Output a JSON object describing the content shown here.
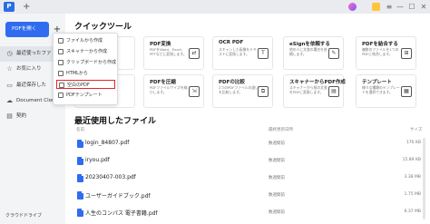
{
  "titlebar": {
    "logo": "P",
    "new_tab": "+"
  },
  "sidebar": {
    "create_button": "PDFを開く",
    "plus": "+",
    "items": [
      {
        "label": "最近使ったファ",
        "icon": "clock-icon",
        "active": true
      },
      {
        "label": "お気に入り",
        "icon": "star-icon",
        "active": false
      },
      {
        "label": "最近保存した",
        "icon": "folder-icon",
        "active": false
      },
      {
        "label": "Document Cloud",
        "icon": "cloud-icon",
        "active": false
      },
      {
        "label": "契約",
        "icon": "contract-icon",
        "active": false
      }
    ],
    "cloud_drive": "クラウドドライブ"
  },
  "menu": {
    "items": [
      {
        "label": "ファイルから作成"
      },
      {
        "label": "スキャナーから作成"
      },
      {
        "label": "クリップボードから作成"
      },
      {
        "label": "HTMLから"
      },
      {
        "label": "空白のPDF"
      },
      {
        "label": "PDFテンプレート"
      }
    ]
  },
  "quick_tools": {
    "title": "クイックツール",
    "cards": [
      {
        "title": "",
        "desc": "",
        "icon": ""
      },
      {
        "title": "PDF変換",
        "desc": "PDFをWord、Excel、PPTなどに変換します。",
        "icon": "⇄"
      },
      {
        "title": "OCR PDF",
        "desc": "スキャンした画像をテキストに変換します。",
        "icon": "T"
      },
      {
        "title": "eSignを依頼する",
        "desc": "他の人に文書の署名を依頼します。",
        "icon": "✎"
      },
      {
        "title": "PDFを結合する",
        "desc": "複数のファイルを1つのPDFに結合します。",
        "icon": "⊞"
      },
      {
        "title": "",
        "desc": "",
        "icon": ""
      },
      {
        "title": "PDFを圧縮",
        "desc": "PDFファイルサイズを縮小します。",
        "icon": "⇲"
      },
      {
        "title": "PDFの比較",
        "desc": "2つのPDFファイルの違いを比較します。",
        "icon": "⧉"
      },
      {
        "title": "スキャナーからPDF作成",
        "desc": "スキャナーから紙の文書をPDFに変換します。",
        "icon": "▤"
      },
      {
        "title": "テンプレート",
        "desc": "様々な種類のテンプレートを選択できます。",
        "icon": "▦"
      }
    ]
  },
  "recent_files": {
    "title": "最近使用したファイル",
    "columns": {
      "name": "名前",
      "date": "最終更新日時",
      "size": "サイズ"
    },
    "rows": [
      {
        "name": "login_84807.pdf",
        "date": "数週間前",
        "size": "176 KB"
      },
      {
        "name": "iryou.pdf",
        "date": "数週間前",
        "size": "15.89 KB"
      },
      {
        "name": "20230407-003.pdf",
        "date": "数週間前",
        "size": "3.38 MB"
      },
      {
        "name": "ユーザーガイドブック.pdf",
        "date": "数週間前",
        "size": "1.75 MB"
      },
      {
        "name": "人生のコンパス 電子書籍.pdf",
        "date": "数週間前",
        "size": "6.37 MB"
      }
    ]
  },
  "colors": {
    "accent": "#2f6cf0",
    "highlight": "#e0262b"
  }
}
